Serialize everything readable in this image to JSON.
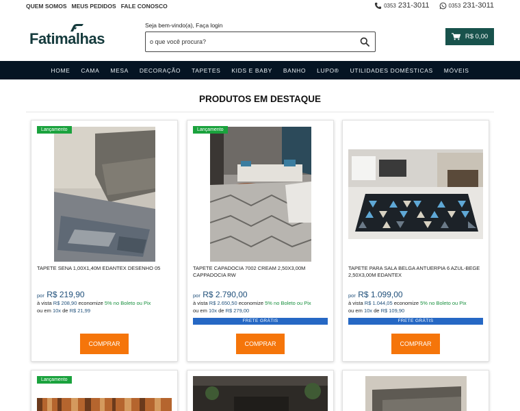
{
  "topbar": {
    "links": [
      "QUEM SOMOS",
      "MEUS PEDIDOS",
      "FALE CONOSCO"
    ],
    "phone1_prefix": "0353",
    "phone1_number": "231-3011",
    "phone2_prefix": "0353",
    "phone2_number": "231-3011"
  },
  "header": {
    "logo_text": "Fatimalhas",
    "login_text": "Seja bem-vindo(a), Faça login",
    "search_placeholder": "o que você procura?",
    "cart_total": "R$ 0,00"
  },
  "nav": [
    "HOME",
    "CAMA",
    "MESA",
    "DECORAÇÃO",
    "TAPETES",
    "KIDS E BABY",
    "BANHO",
    "LUPO®",
    "UTILIDADES DOMÉSTICAS",
    "MÓVEIS"
  ],
  "section": {
    "title": "PRODUTOS EM DESTAQUE"
  },
  "products": [
    {
      "badge": "Lançamento",
      "name": "TAPETE SENA 1,00X1,40M EDANTEX DESENHO 05",
      "por": "por",
      "price": "R$ 219,90",
      "vista_prefix": "à vista",
      "vista_price": "R$ 208,90",
      "vista_mid": "economize",
      "vista_disc": "5% no Boleto ou Pix",
      "parc_prefix": "ou em",
      "parc_n": "10x",
      "parc_mid": "de",
      "parc_val": "R$ 21,99",
      "frete": "",
      "buy": "COMPRAR"
    },
    {
      "badge": "Lançamento",
      "name": "TAPETE CAPADOCIA 7002 CREAM 2,50X3,00M CAPPADOCIA RW",
      "por": "por",
      "price": "R$ 2.790,00",
      "vista_prefix": "à vista",
      "vista_price": "R$ 2.650,50",
      "vista_mid": "economize",
      "vista_disc": "5% no Boleto ou Pix",
      "parc_prefix": "ou em",
      "parc_n": "10x",
      "parc_mid": "de",
      "parc_val": "R$ 279,00",
      "frete": "FRETE GRÁTIS",
      "buy": "COMPRAR"
    },
    {
      "badge": "",
      "name": "TAPETE PARA SALA BELGA ANTUERPIA 6 AZUL-BEGE 2,50X3,00M EDANTEX",
      "por": "por",
      "price": "R$ 1.099,00",
      "vista_prefix": "à vista",
      "vista_price": "R$ 1.044,05",
      "vista_mid": "economize",
      "vista_disc": "5% no Boleto ou Pix",
      "parc_prefix": "ou em",
      "parc_n": "10x",
      "parc_mid": "de",
      "parc_val": "R$ 109,90",
      "frete": "FRETE GRÁTIS",
      "buy": "COMPRAR"
    }
  ],
  "row2": {
    "badge": "Lançamento"
  },
  "colors": {
    "nav_bg": "#051423",
    "cart_bg": "#18524c",
    "buy_bg": "#f5750a",
    "badge_bg": "#1aa23d",
    "frete_bg": "#2668c4",
    "price": "#1f4f7a"
  }
}
